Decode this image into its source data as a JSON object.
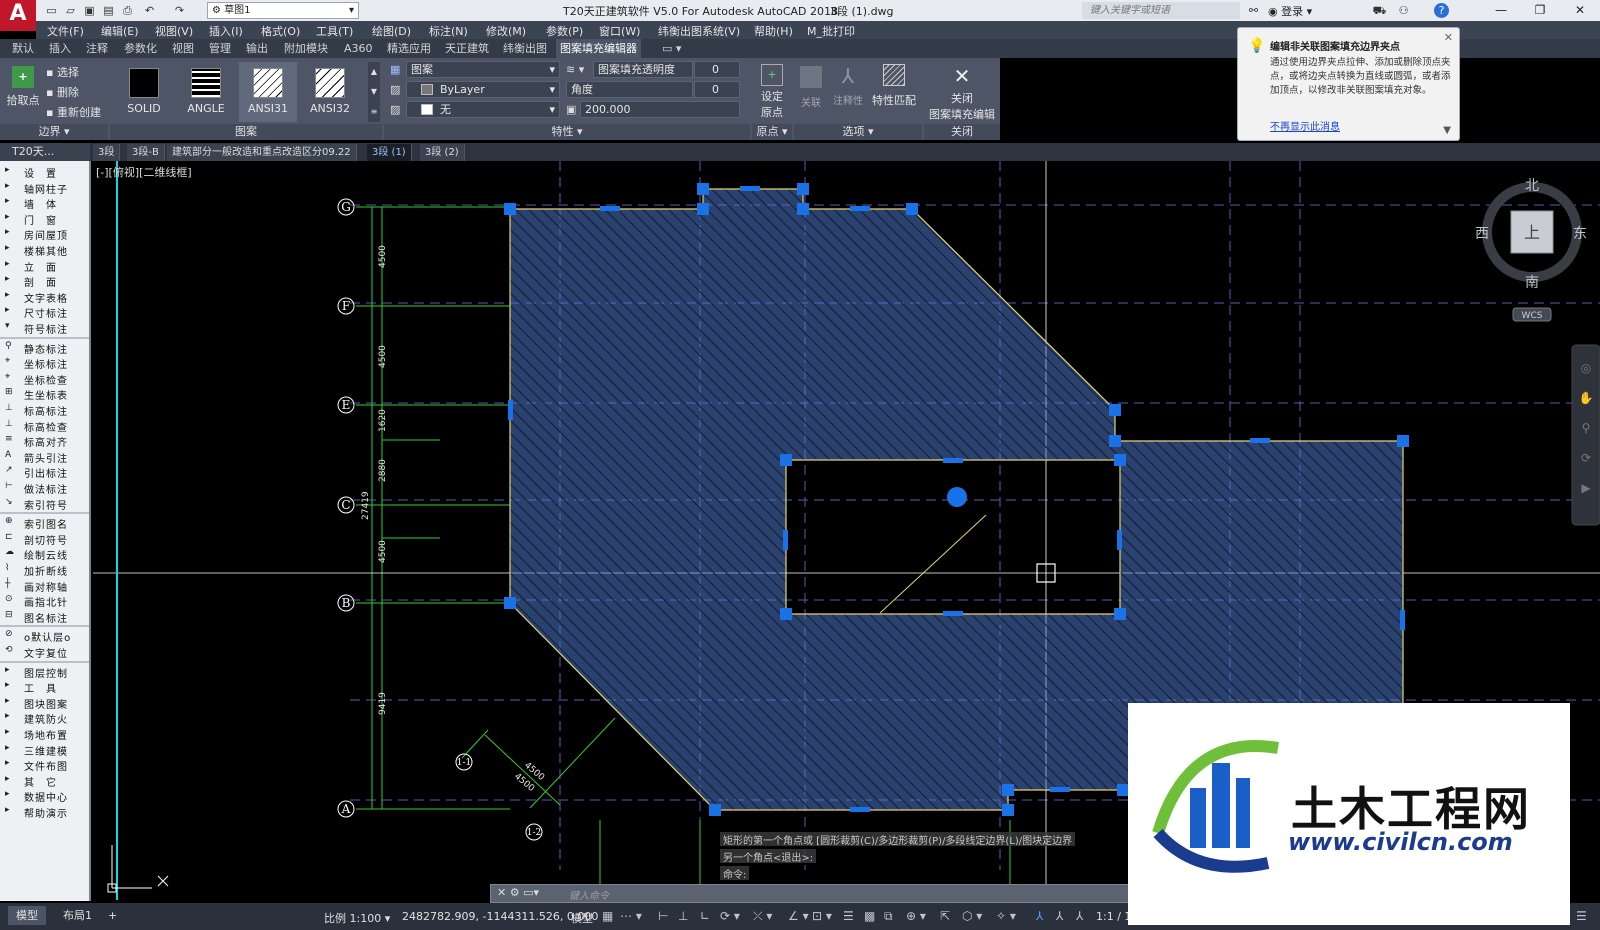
{
  "titlebar": {
    "app_logo": "A",
    "workspace": "草图1",
    "title": "T20天正建筑软件 V5.0 For Autodesk AutoCAD 2018",
    "file": "3段 (1).dwg",
    "search_placeholder": "键入关键字或短语",
    "login": "登录",
    "help": "?"
  },
  "menu": [
    "文件(F)",
    "编辑(E)",
    "视图(V)",
    "插入(I)",
    "格式(O)",
    "工具(T)",
    "绘图(D)",
    "标注(N)",
    "修改(M)",
    "参数(P)",
    "窗口(W)",
    "纬衡出图系统(V)",
    "帮助(H)",
    "M_批打印"
  ],
  "ribbon_tabs": [
    "默认",
    "插入",
    "注释",
    "参数化",
    "视图",
    "管理",
    "输出",
    "附加模块",
    "A360",
    "精选应用",
    "天正建筑",
    "纬衡出图",
    "图案填充编辑器"
  ],
  "ribbon_active_tab": "图案填充编辑器",
  "ribbon": {
    "boundary": {
      "pick_point": "拾取点",
      "select": "选择",
      "remove": "删除",
      "recreate": "重新创建",
      "label": "边界"
    },
    "patterns": [
      {
        "name": "SOLID",
        "selected": false
      },
      {
        "name": "ANGLE",
        "selected": false
      },
      {
        "name": "ANSI31",
        "selected": true
      },
      {
        "name": "ANSI32",
        "selected": false
      }
    ],
    "pattern_label": "图案",
    "properties": {
      "type": "图案",
      "color": "ByLayer",
      "bgcolor": "无",
      "transparency_label": "图案填充透明度",
      "transparency": "0",
      "angle_label": "角度",
      "angle": "0",
      "scale": "200.000",
      "label": "特性"
    },
    "origin": {
      "set": "设定",
      "origin": "原点",
      "label": "原点"
    },
    "options": {
      "associative": "关联",
      "annotative": "注释性",
      "match": "特性匹配",
      "label": "选项"
    },
    "close": {
      "line1": "关闭",
      "line2": "图案填充编辑器",
      "label": "关闭"
    }
  },
  "notification": {
    "title": "编辑非关联图案填充边界夹点",
    "body": "通过使用边界夹点拉伸、添加或删除顶点夹点，或将边夹点转换为直线或圆弧，或者添加顶点，以修改非关联图案填充对象。",
    "link": "不再显示此消息"
  },
  "doc_tabs": {
    "side_title": "T20天...",
    "tabs": [
      "3段",
      "3段-B",
      "建筑部分一般改造和重点改造区分09.22",
      "3段 (1)",
      "3段 (2)"
    ],
    "active": "3段 (1)"
  },
  "palette": [
    {
      "t": "设　置",
      "i": "▸"
    },
    {
      "t": "轴网柱子",
      "i": "▸"
    },
    {
      "t": "墙　体",
      "i": "▸"
    },
    {
      "t": "门　窗",
      "i": "▸"
    },
    {
      "t": "房间屋顶",
      "i": "▸"
    },
    {
      "t": "楼梯其他",
      "i": "▸"
    },
    {
      "t": "立　面",
      "i": "▸"
    },
    {
      "t": "剖　面",
      "i": "▸"
    },
    {
      "t": "文字表格",
      "i": "▸"
    },
    {
      "t": "尺寸标注",
      "i": "▸"
    },
    {
      "t": "符号标注",
      "i": "▾"
    },
    {
      "t": "静态标注",
      "i": "⚲"
    },
    {
      "t": "坐标标注",
      "i": "⌖"
    },
    {
      "t": "坐标检查",
      "i": "⌖"
    },
    {
      "t": "生坐标表",
      "i": "⊞"
    },
    {
      "t": "标高标注",
      "i": "⊥"
    },
    {
      "t": "标高检查",
      "i": "⊥"
    },
    {
      "t": "标高对齐",
      "i": "≡"
    },
    {
      "t": "箭头引注",
      "i": "A"
    },
    {
      "t": "引出标注",
      "i": "↗"
    },
    {
      "t": "做法标注",
      "i": "⊢"
    },
    {
      "t": "索引符号",
      "i": "↘"
    },
    {
      "t": "索引图名",
      "i": "⊕"
    },
    {
      "t": "剖切符号",
      "i": "⊏"
    },
    {
      "t": "绘制云线",
      "i": "☁"
    },
    {
      "t": "加折断线",
      "i": "⌇"
    },
    {
      "t": "画对称轴",
      "i": "┼"
    },
    {
      "t": "画指北针",
      "i": "⊙"
    },
    {
      "t": "图名标注",
      "i": "⊟"
    },
    {
      "t": "o默认层o",
      "i": "⊘"
    },
    {
      "t": "文字复位",
      "i": "⟲"
    },
    {
      "t": "图层控制",
      "i": "▸"
    },
    {
      "t": "工　具",
      "i": "▸"
    },
    {
      "t": "图块图案",
      "i": "▸"
    },
    {
      "t": "建筑防火",
      "i": "▸"
    },
    {
      "t": "场地布置",
      "i": "▸"
    },
    {
      "t": "三维建模",
      "i": "▸"
    },
    {
      "t": "文件布图",
      "i": "▸"
    },
    {
      "t": "其　它",
      "i": "▸"
    },
    {
      "t": "数据中心",
      "i": "▸"
    },
    {
      "t": "帮助演示",
      "i": "▸"
    }
  ],
  "canvas": {
    "view_label": "[-][俯视][二维线框]",
    "axes": [
      "G",
      "F",
      "E",
      "C",
      "B",
      "A"
    ],
    "dims": [
      "4500",
      "4500",
      "1620",
      "2880",
      "4500",
      "9419"
    ],
    "overall_dim": "27419",
    "section_labels": [
      "1-1",
      "1-2"
    ],
    "section_dims": [
      "4500",
      "4500"
    ],
    "viewcube": {
      "north": "北",
      "south": "南",
      "west": "西",
      "east": "东",
      "top": "上",
      "wcs": "WCS"
    }
  },
  "command": {
    "history": [
      "矩形的第一个角点或 [圆形裁剪(C)/多边形裁剪(P)/多段线定边界(L)/图块定边界",
      "另一个角点<退出>:",
      "命令:"
    ],
    "prompt": "键入命令"
  },
  "status": {
    "tabs": [
      "模型",
      "布局1"
    ],
    "scale": "比例 1:100",
    "coords": "2482782.909, -1144311.526, 0.000",
    "model": "模型",
    "anno_scale": "1:1 / 10"
  },
  "watermark": {
    "name": "土木工程网",
    "url": "www.civilcn.com"
  },
  "colors": {
    "hatch_fill": "#4d78c9",
    "grip": "#1a72e8",
    "axis_line": "#33cc33",
    "grid_dash": "#5a5ab4",
    "ribbon_bg": "#4d5566"
  }
}
